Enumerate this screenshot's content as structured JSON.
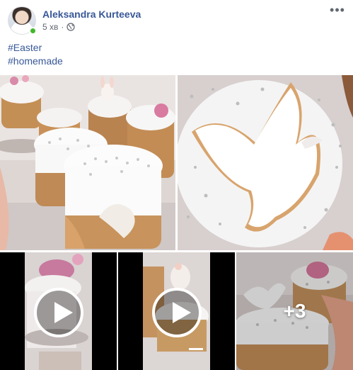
{
  "post": {
    "author": "Aleksandra Kurteeva",
    "timestamp": "5 хв",
    "separator": "·",
    "privacy_icon": "globe-icon",
    "more_icon": "more-options-icon",
    "more_label": "•••",
    "hashtags": [
      "#Easter",
      "#homemade"
    ]
  },
  "media": {
    "photos": [
      {
        "name": "easter-cakes-group-photo"
      },
      {
        "name": "dove-cake-closeup-photo"
      }
    ],
    "videos": [
      {
        "name": "easter-video-1",
        "play_icon": "play-icon"
      },
      {
        "name": "easter-video-2",
        "play_icon": "play-icon"
      }
    ],
    "more_count_label": "+3"
  },
  "colors": {
    "link": "#385898",
    "online": "#42b72a",
    "meta": "#616770"
  }
}
